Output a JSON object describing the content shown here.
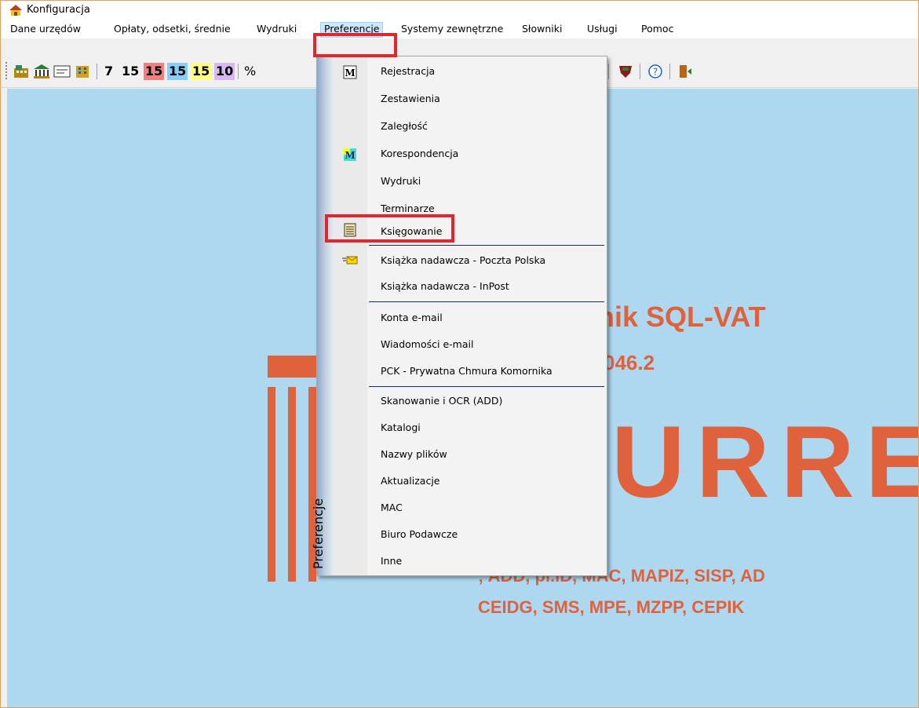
{
  "window": {
    "title": "Konfiguracja"
  },
  "menubar": {
    "items": [
      {
        "label": "Dane urzędów"
      },
      {
        "label": "Opłaty, odsetki, średnie"
      },
      {
        "label": "Wydruki"
      },
      {
        "label": "Preferencje"
      },
      {
        "label": "Systemy zewnętrzne"
      },
      {
        "label": "Słowniki"
      },
      {
        "label": "Usługi"
      },
      {
        "label": "Pomoc"
      }
    ]
  },
  "toolbar": {
    "numbers": [
      {
        "label": "7",
        "bg": "transparent"
      },
      {
        "label": "15",
        "bg": "transparent"
      },
      {
        "label": "15",
        "bg": "#f08080"
      },
      {
        "label": "15",
        "bg": "#87cefa"
      },
      {
        "label": "15",
        "bg": "#ffff80"
      },
      {
        "label": "10",
        "bg": "#d8b8f0"
      }
    ],
    "percent": "%"
  },
  "dropdown": {
    "side_label": "Preferencje",
    "items": [
      {
        "label": "Rejestracja",
        "icon": "m-icon"
      },
      {
        "label": "Zestawienia"
      },
      {
        "label": "Zaległość"
      },
      {
        "label": "Korespondencja",
        "icon": "m-color-icon"
      },
      {
        "label": "Wydruki"
      },
      {
        "label": "Terminarze"
      },
      {
        "label": "Księgowanie",
        "icon": "ledger-icon"
      },
      {
        "label": "Książka nadawcza - Poczta Polska",
        "icon": "mail-envelope-icon"
      },
      {
        "label": "Książka nadawcza - InPost"
      },
      {
        "label": "Konta e-mail"
      },
      {
        "label": "Wiadomości e-mail"
      },
      {
        "label": "PCK - Prywatna Chmura Komornika"
      },
      {
        "label": "Skanowanie i OCR (ADD)"
      },
      {
        "label": "Katalogi"
      },
      {
        "label": "Nazwy plików"
      },
      {
        "label": "Aktualizacje"
      },
      {
        "label": "MAC"
      },
      {
        "label": "Biuro Podawcze"
      },
      {
        "label": "Inne"
      }
    ]
  },
  "background": {
    "title": "nik SQL-VAT",
    "version": "046.2",
    "logo": "URRE",
    "modules_line1": "; ADD, pl.ID, MAC, MAPIZ, SISP, AD",
    "modules_line2": "CEIDG, SMS, MPE, MZPP, CEPIK"
  },
  "colors": {
    "brand_orange": "#e0623c",
    "client_bg": "#add8f0",
    "highlight_red": "#e3262e"
  }
}
